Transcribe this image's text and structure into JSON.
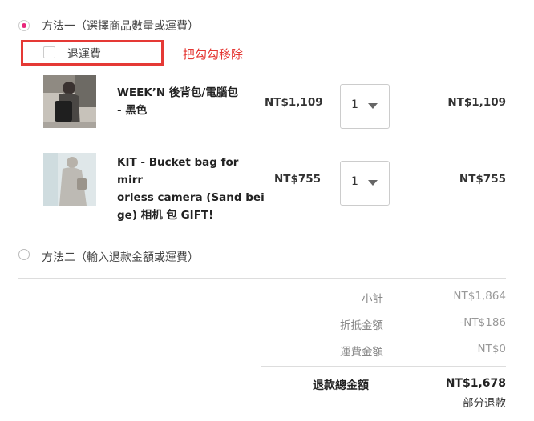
{
  "method1": {
    "label": "方法一（選擇商品數量或運費）",
    "selected": true
  },
  "return_shipping": {
    "label": "退運費",
    "checked": false
  },
  "annotation": {
    "text": "把勾勾移除",
    "color": "#e53935"
  },
  "items": [
    {
      "name_line1": "WEEK’N 後背包/電腦包",
      "name_line2": "- 黑色",
      "name_line3": "",
      "unit_price": "NT$1,109",
      "quantity": "1",
      "subtotal": "NT$1,109"
    },
    {
      "name_line1": "KIT - Bucket bag for mirr",
      "name_line2": "orless camera (Sand bei",
      "name_line3": "ge) 相机 包 GIFT!",
      "unit_price": "NT$755",
      "quantity": "1",
      "subtotal": "NT$755"
    }
  ],
  "method2": {
    "label": "方法二（輸入退款金額或運費）",
    "selected": false
  },
  "summary": {
    "subtotal_label": "小計",
    "subtotal_value": "NT$1,864",
    "discount_label": "折抵金額",
    "discount_value": "-NT$186",
    "shipping_label": "運費金額",
    "shipping_value": "NT$0",
    "total_label": "退款總金額",
    "total_value": "NT$1,678",
    "total_note": "部分退款"
  },
  "colors": {
    "accent": "#e8267a",
    "annotation": "#e53935"
  }
}
